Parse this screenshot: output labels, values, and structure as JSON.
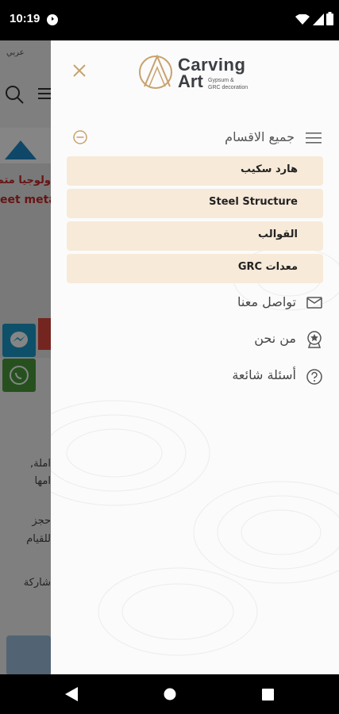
{
  "status_bar": {
    "time": "10:19"
  },
  "background_page": {
    "language": "عربي",
    "hero_line1": "ولوجيا متم",
    "hero_line2": "eet meta",
    "body_lines": [
      "املة,",
      "امها",
      "حجز",
      "للقيام",
      "شاركة"
    ]
  },
  "drawer": {
    "logo": {
      "word1": "Carving",
      "word2": "Art",
      "tagline1": "Gypsum &",
      "tagline2": "GRC decoration"
    },
    "categories_title": "جميع الاقسام",
    "categories": [
      {
        "label": "هارد سكيب"
      },
      {
        "label": "Steel Structure"
      },
      {
        "label": "القوالب"
      },
      {
        "label": "معدات GRC"
      }
    ],
    "nav": [
      {
        "label": "تواصل معنا",
        "icon": "mail-icon"
      },
      {
        "label": "من نحن",
        "icon": "award-icon"
      },
      {
        "label": "أسئلة شائعة",
        "icon": "help-icon"
      }
    ]
  },
  "colors": {
    "accent": "#c8a26e",
    "category_bg": "#f7ead9"
  }
}
